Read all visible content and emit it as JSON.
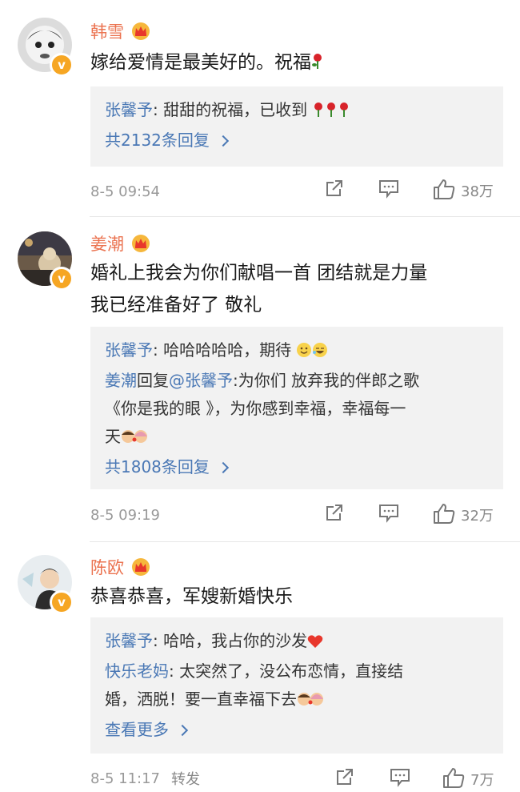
{
  "comments": [
    {
      "user": "韩雪",
      "text": "嫁给爱情是最美好的。祝福",
      "replies": [
        {
          "user": "张馨予",
          "text": ": 甜甜的祝福，已收到"
        }
      ],
      "more": "共2132条回复",
      "time": "8-5 09:54",
      "repost": "",
      "likes": "38万"
    },
    {
      "user": "姜潮",
      "text_line1": "婚礼上我会为你们献唱一首 团结就是力量",
      "text_line2": "我已经准备好了 敬礼",
      "replies": [
        {
          "user": "张馨予",
          "text": ": 哈哈哈哈哈，期待"
        },
        {
          "user": "姜潮",
          "mid": "回复",
          "mention": "@张馨予",
          "text": ":为你们 放弃我的伴郎之歌",
          "line2": "《你是我的眼 》，为你感到幸福，幸福每一",
          "line3": "天"
        }
      ],
      "more": "共1808条回复",
      "time": "8-5 09:19",
      "repost": "",
      "likes": "32万"
    },
    {
      "user": "陈欧",
      "text": "恭喜恭喜，军嫂新婚快乐",
      "replies": [
        {
          "user": "张馨予",
          "text": ": 哈哈，我占你的沙发"
        },
        {
          "user": "快乐老妈",
          "text": ": 太突然了，没公布恋情，直接结",
          "line2": "婚，洒脱！要一直幸福下去"
        }
      ],
      "more": "查看更多",
      "time": "8-5 11:17",
      "repost": "转发",
      "likes": "7万"
    }
  ],
  "icons": {
    "crown": "crown-icon",
    "verified": "verified-badge-icon",
    "share": "share-icon",
    "comment": "comment-icon",
    "like": "like-icon",
    "rose": "rose-emoji",
    "heart": "heart-emoji"
  },
  "colors": {
    "username": "#eb7350",
    "link": "#4a78b5",
    "reply_bg": "#f2f2f2",
    "meta": "#999999"
  }
}
